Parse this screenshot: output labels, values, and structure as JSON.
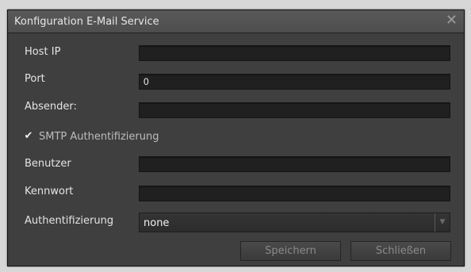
{
  "dialog": {
    "title": "Konfiguration E-Mail Service",
    "close_icon": "✕"
  },
  "fields": {
    "host_ip": {
      "label": "Host IP",
      "value": ""
    },
    "port": {
      "label": "Port",
      "value": "0"
    },
    "absender": {
      "label": "Absender:",
      "value": ""
    },
    "benutzer": {
      "label": "Benutzer",
      "value": ""
    },
    "kennwort": {
      "label": "Kennwort",
      "value": ""
    }
  },
  "smtp": {
    "label": "SMTP Authentifizierung",
    "checked": true,
    "check_glyph": "✔"
  },
  "auth": {
    "label": "Authentifizierung",
    "value": "none",
    "arrow_glyph": "▼"
  },
  "buttons": {
    "save": "Speichern",
    "close": "Schließen"
  }
}
